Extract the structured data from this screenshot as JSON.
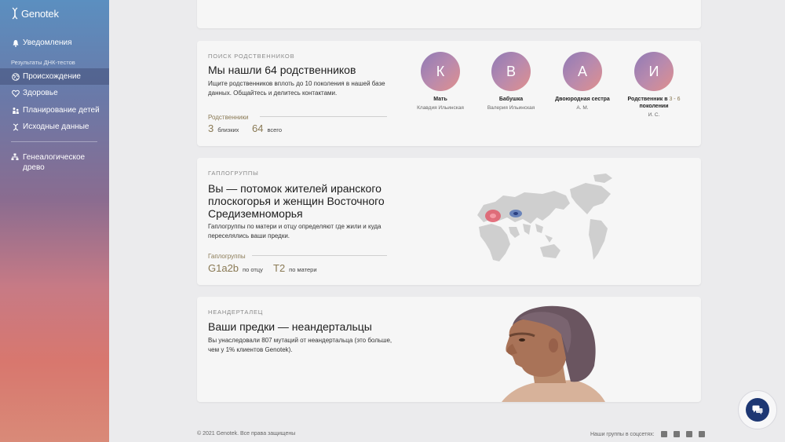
{
  "app": {
    "brand": "Genotek"
  },
  "sidebar": {
    "notifications": "Уведомления",
    "section_title": "Результаты ДНК-тестов",
    "items": [
      {
        "label": "Происхождение",
        "icon": "globe-icon",
        "active": true
      },
      {
        "label": "Здоровье",
        "icon": "heart-icon",
        "active": false
      },
      {
        "label": "Планирование детей",
        "icon": "family-icon",
        "active": false
      },
      {
        "label": "Исходные данные",
        "icon": "dna-icon",
        "active": false
      }
    ],
    "tree": "Генеалогическое древо"
  },
  "relatives": {
    "eyebrow": "ПОИСК РОДСТВЕННИКОВ",
    "title": "Мы нашли 64 родственников",
    "desc_line1": "Ищите родственников вплоть до 10 поколения в нашей базе",
    "desc_line2": "данных. Общайтесь и делитесь контактами.",
    "stats_label": "Родственники",
    "close_num": "3",
    "close_label": "близких",
    "total_num": "64",
    "total_label": "всего",
    "people": [
      {
        "initial": "К",
        "relation": "Мать",
        "relation_extra": "",
        "name": "Клавдия Ильинская"
      },
      {
        "initial": "В",
        "relation": "Бабушка",
        "relation_extra": "",
        "name": "Валерия Ильинская"
      },
      {
        "initial": "А",
        "relation": "Двоюродная сестра",
        "relation_extra": "",
        "name": "А. М."
      },
      {
        "initial": "И",
        "relation": "Родственник в",
        "relation_extra": "3 - 6",
        "relation_line2": "поколении",
        "name": "И. С."
      }
    ]
  },
  "haplo": {
    "eyebrow": "ГАПЛОГРУППЫ",
    "title_line1": "Вы — потомок жителей иранского",
    "title_line2": "плоскогорья и женщин Восточного",
    "title_line3": "Средиземноморья",
    "desc_line1": "Гаплогруппы по матери и отцу определяют где жили и куда",
    "desc_line2": "переселялись ваши предки.",
    "stats_label": "Гаплогруппы",
    "father_num": "G1a2b",
    "father_label": "по отцу",
    "mother_num": "T2",
    "mother_label": "по матери"
  },
  "neanderthal": {
    "eyebrow": "НЕАНДЕРТАЛЕЦ",
    "title": "Ваши предки — неандертальцы",
    "desc_line1": "Вы унаследовали 807 мутаций от неандертальца (это больше,",
    "desc_line2": "чем у 1% клиентов Genotek)."
  },
  "footer": {
    "copyright": "© 2021 Genotek. Все права защищены",
    "social_label": "Наши группы в соцсетях:",
    "social": [
      "facebook-icon",
      "twitter-icon",
      "instagram-icon",
      "vk-icon"
    ]
  },
  "colors": {
    "accent": "#8a7a55",
    "chat": "#1d3773"
  }
}
